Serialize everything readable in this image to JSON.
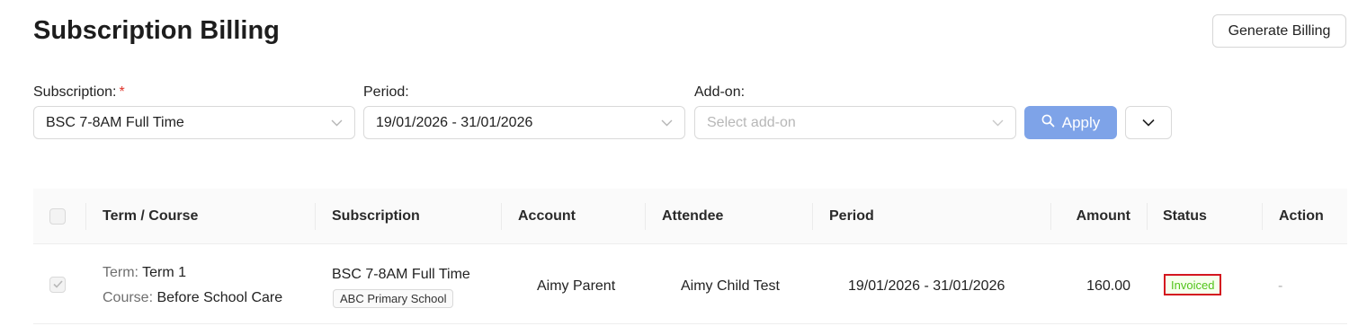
{
  "page": {
    "title": "Subscription Billing"
  },
  "header": {
    "generate_label": "Generate Billing"
  },
  "filters": {
    "subscription": {
      "label": "Subscription:",
      "required_mark": "*",
      "value": "BSC 7-8AM Full Time"
    },
    "period": {
      "label": "Period:",
      "value": "19/01/2026 - 31/01/2026"
    },
    "addon": {
      "label": "Add-on:",
      "placeholder": "Select add-on"
    },
    "apply_label": "Apply"
  },
  "table": {
    "columns": [
      "Term / Course",
      "Subscription",
      "Account",
      "Attendee",
      "Period",
      "Amount",
      "Status",
      "Action"
    ],
    "rows": [
      {
        "term_label": "Term:",
        "term_value": "Term 1",
        "course_label": "Course:",
        "course_value": "Before School Care",
        "subscription": "BSC 7-8AM Full Time",
        "school": "ABC Primary School",
        "account": "Aimy Parent",
        "attendee": "Aimy Child Test",
        "period": "19/01/2026 - 31/01/2026",
        "amount": "160.00",
        "status": "Invoiced",
        "action": "-"
      }
    ]
  },
  "colors": {
    "accent": "#7ea3e8",
    "status_green": "#52c41a",
    "highlight_red": "#d4171f"
  },
  "icons": {
    "chevron": "chevron-down-icon",
    "search": "search-icon",
    "check": "check-icon"
  }
}
